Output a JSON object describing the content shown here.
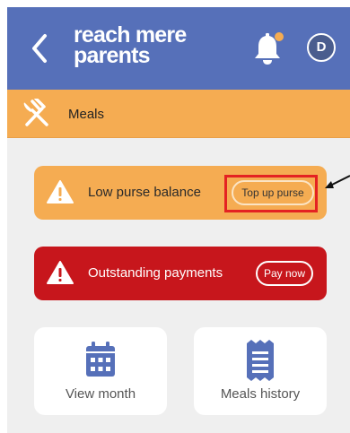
{
  "header": {
    "logo_line1": "reach mere",
    "logo_line2": "parents",
    "avatar_initial": "D",
    "notification_dot_color": "#f5ac52"
  },
  "section": {
    "title": "Meals"
  },
  "alerts": [
    {
      "text": "Low purse balance",
      "button": "Top up purse",
      "color": "#f5ac52"
    },
    {
      "text": "Outstanding payments",
      "button": "Pay now",
      "color": "#c7161c"
    }
  ],
  "tiles": [
    {
      "label": "View month",
      "icon": "calendar-icon"
    },
    {
      "label": "Meals history",
      "icon": "receipt-icon"
    }
  ],
  "colors": {
    "header": "#5670b9",
    "accent": "#f5ac52",
    "danger": "#c7161c",
    "tile_icon": "#5670b9"
  }
}
